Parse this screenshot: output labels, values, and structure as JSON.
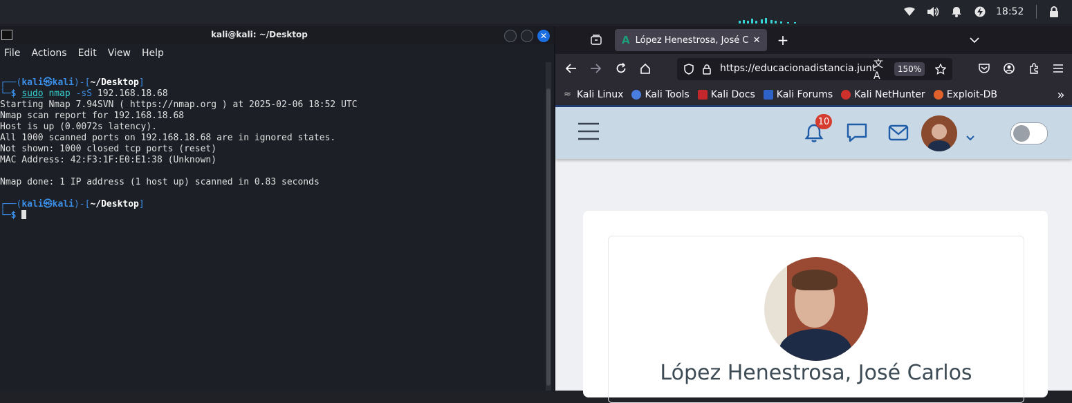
{
  "top_panel": {
    "clock": "18:52",
    "icons": [
      "wifi-icon",
      "volume-icon",
      "notifications-icon",
      "power-status-icon",
      "lock-icon",
      "logout-icon"
    ]
  },
  "terminal": {
    "title": "kali@kali: ~/Desktop",
    "menu": [
      "File",
      "Actions",
      "Edit",
      "View",
      "Help"
    ],
    "prompt": {
      "user_host_left": "kali",
      "at": "㉿",
      "host": "kali",
      "path": "~/Desktop"
    },
    "command": {
      "sudo": "sudo",
      "cmd": "nmap",
      "flag": "-sS",
      "target": "192.168.18.68"
    },
    "output": [
      "Starting Nmap 7.94SVN ( https://nmap.org ) at 2025-02-06 18:52 UTC",
      "Nmap scan report for 192.168.18.68",
      "Host is up (0.0072s latency).",
      "All 1000 scanned ports on 192.168.18.68 are in ignored states.",
      "Not shown: 1000 closed tcp ports (reset)",
      "MAC Address: 42:F3:1F:E0:E1:38 (Unknown)",
      "",
      "Nmap done: 1 IP address (1 host up) scanned in 0.83 seconds"
    ]
  },
  "browser": {
    "tab_title": "López Henestrosa, José C",
    "url": "https://educacionadistancia.junt",
    "zoom": "150%",
    "bookmarks": [
      "Kali Linux",
      "Kali Tools",
      "Kali Docs",
      "Kali Forums",
      "Kali NetHunter",
      "Exploit-DB"
    ],
    "site": {
      "notification_count": "10",
      "profile_name": "López Henestrosa, José Carlos"
    }
  },
  "colors": {
    "terminal_bg": "#1c1f26",
    "prompt_blue": "#3b8ee6",
    "header_blue": "#c8d8e4",
    "badge_red": "#d63b2f",
    "icon_blue": "#1f5ca8"
  }
}
